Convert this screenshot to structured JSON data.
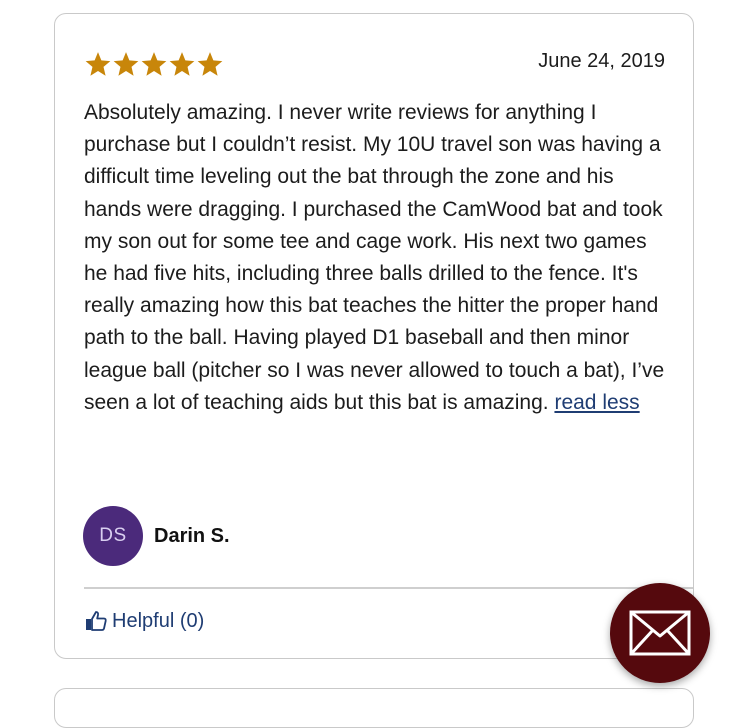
{
  "review": {
    "rating": 5,
    "rating_max": 5,
    "date": "June 24, 2019",
    "text": "Absolutely amazing. I never write reviews for anything I purchase but I couldn’t resist. My 10U travel son was having a difficult time leveling out the bat through the zone and his hands were dragging. I purchased the CamWood bat and took my son out for some tee and cage work. His next two games he had five hits, including three balls drilled to the fence. It's really amazing how this bat teaches the hitter the proper hand path to the ball. Having played D1 baseball and then minor league ball (pitcher so I was never allowed to touch a bat), I’ve seen a lot of teaching aids but this bat is amazing. ",
    "read_less_label": "read less",
    "reviewer": {
      "initials": "DS",
      "name": "Darin S."
    },
    "helpful_label": "Helpful (0)"
  },
  "icons": {
    "star": "star-icon",
    "helpful": "thumbs-up-icon",
    "contact": "envelope-icon"
  },
  "colors": {
    "star": "#c8860a",
    "link": "#1f3d73",
    "avatar_bg": "#4b2a7b",
    "contact_button": "#55090d"
  }
}
